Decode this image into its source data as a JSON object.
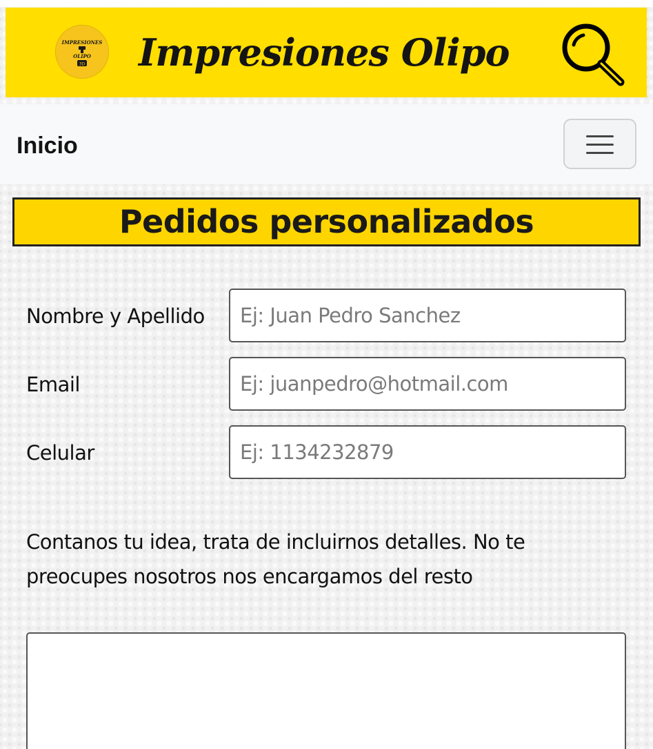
{
  "header": {
    "brand_title": "Impresiones Olipo",
    "logo_text_top": "IMPRESIONES",
    "logo_text_mid": "OLIPO",
    "logo_text_bottom": "3D",
    "banner_color": "#ffde00",
    "search_icon": "search-icon"
  },
  "navbar": {
    "home_label": "Inicio",
    "menu_icon": "hamburger-menu-icon"
  },
  "section": {
    "title": "Pedidos personalizados"
  },
  "form": {
    "name": {
      "label": "Nombre y Apellido",
      "placeholder": "Ej: Juan Pedro Sanchez",
      "value": ""
    },
    "email": {
      "label": "Email",
      "placeholder": "Ej: juanpedro@hotmail.com",
      "value": ""
    },
    "phone": {
      "label": "Celular",
      "placeholder": "Ej: 1134232879",
      "value": ""
    },
    "idea": {
      "label": "Contanos tu idea, trata de incluirnos detalles. No te preocupes nosotros nos encargamos del resto",
      "value": ""
    }
  }
}
